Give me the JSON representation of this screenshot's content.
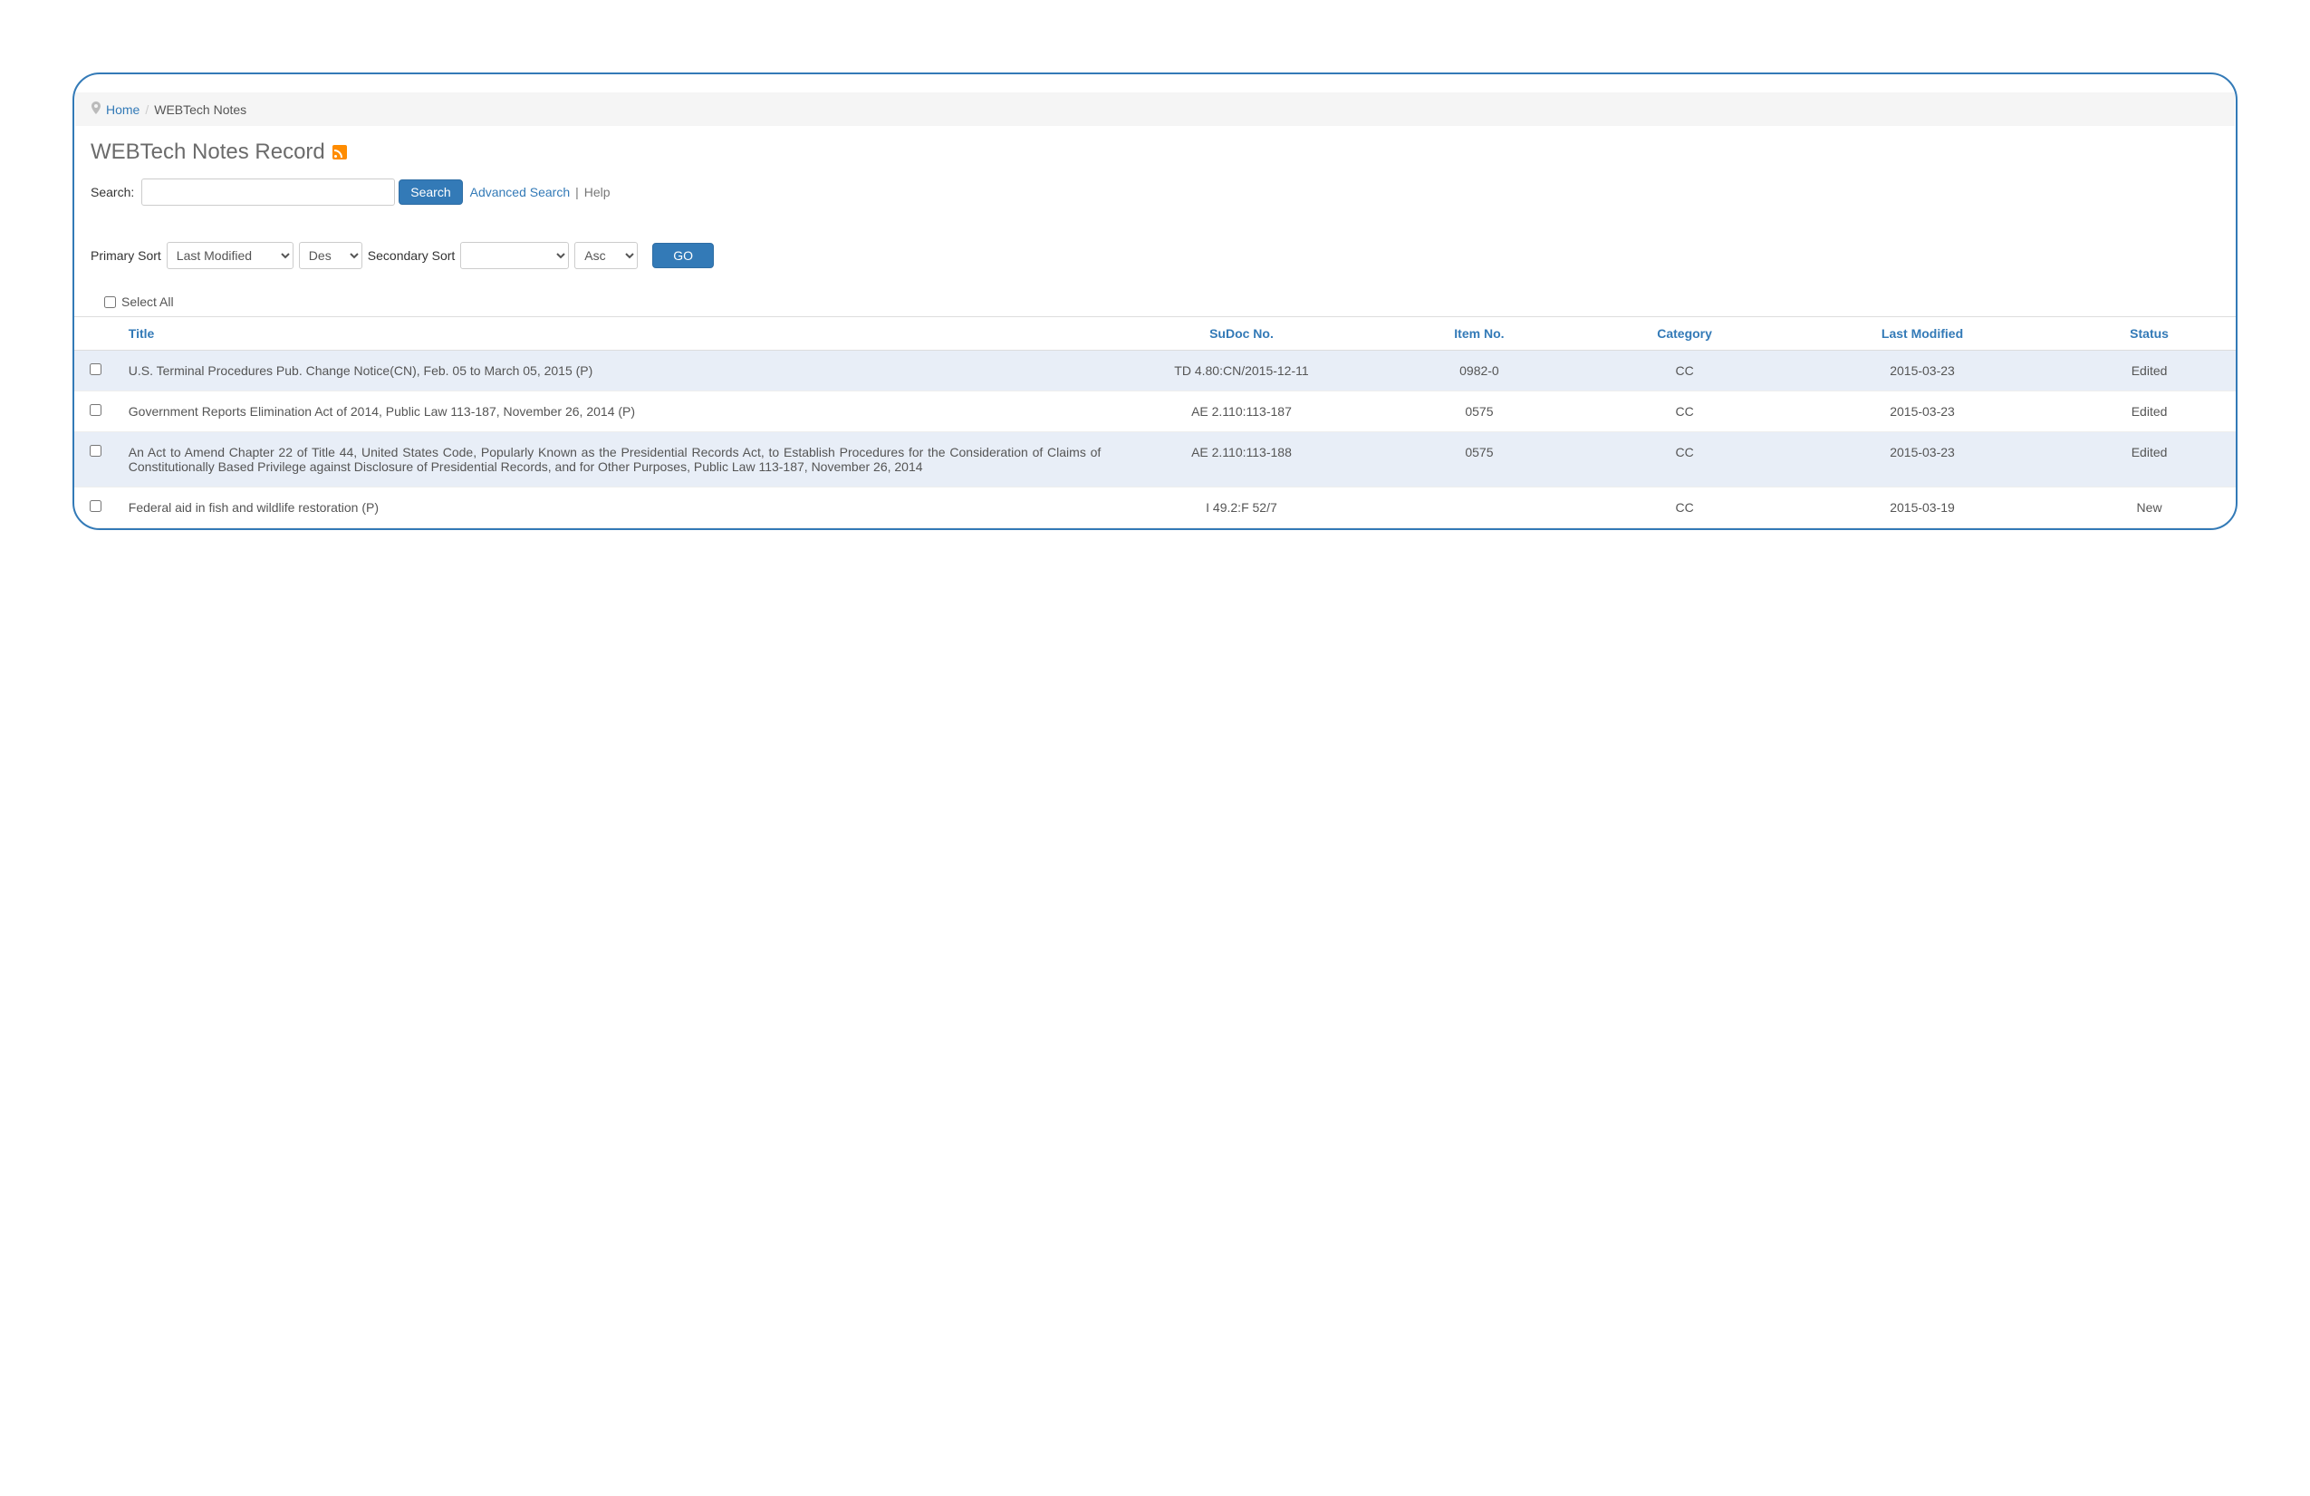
{
  "breadcrumb": {
    "home": "Home",
    "current": "WEBTech Notes"
  },
  "page_title": "WEBTech Notes Record",
  "search": {
    "label": "Search:",
    "button": "Search",
    "advanced": "Advanced Search",
    "help": "Help",
    "value": ""
  },
  "sort": {
    "primary_label": "Primary Sort",
    "primary_value": "Last Modified",
    "primary_dir": "Des",
    "secondary_label": "Secondary Sort",
    "secondary_value": "",
    "secondary_dir": "Asc",
    "go": "GO"
  },
  "select_all_label": "Select All",
  "columns": {
    "title": "Title",
    "sudoc": "SuDoc No.",
    "item": "Item No.",
    "category": "Category",
    "last_modified": "Last Modified",
    "status": "Status"
  },
  "rows": [
    {
      "title": "U.S. Terminal Procedures Pub. Change Notice(CN), Feb. 05 to March 05, 2015 (P)",
      "sudoc": "TD 4.80:CN/2015-12-11",
      "item": "0982-0",
      "category": "CC",
      "last_modified": "2015-03-23",
      "status": "Edited"
    },
    {
      "title": "Government Reports Elimination Act of 2014, Public Law 113-187, November 26, 2014 (P)",
      "sudoc": "AE 2.110:113-187",
      "item": "0575",
      "category": "CC",
      "last_modified": "2015-03-23",
      "status": "Edited"
    },
    {
      "title": "An Act to Amend Chapter 22 of Title 44, United States Code, Popularly Known as the Presidential Records Act, to Establish Procedures for the Consideration of Claims of Constitutionally Based Privilege against Disclosure of Presidential Records, and for Other Purposes, Public Law 113-187, November 26, 2014",
      "sudoc": "AE 2.110:113-188",
      "item": "0575",
      "category": "CC",
      "last_modified": "2015-03-23",
      "status": "Edited"
    },
    {
      "title": "Federal aid in fish and wildlife restoration (P)",
      "sudoc": "I 49.2:F 52/7",
      "item": "",
      "category": "CC",
      "last_modified": "2015-03-19",
      "status": "New"
    }
  ]
}
